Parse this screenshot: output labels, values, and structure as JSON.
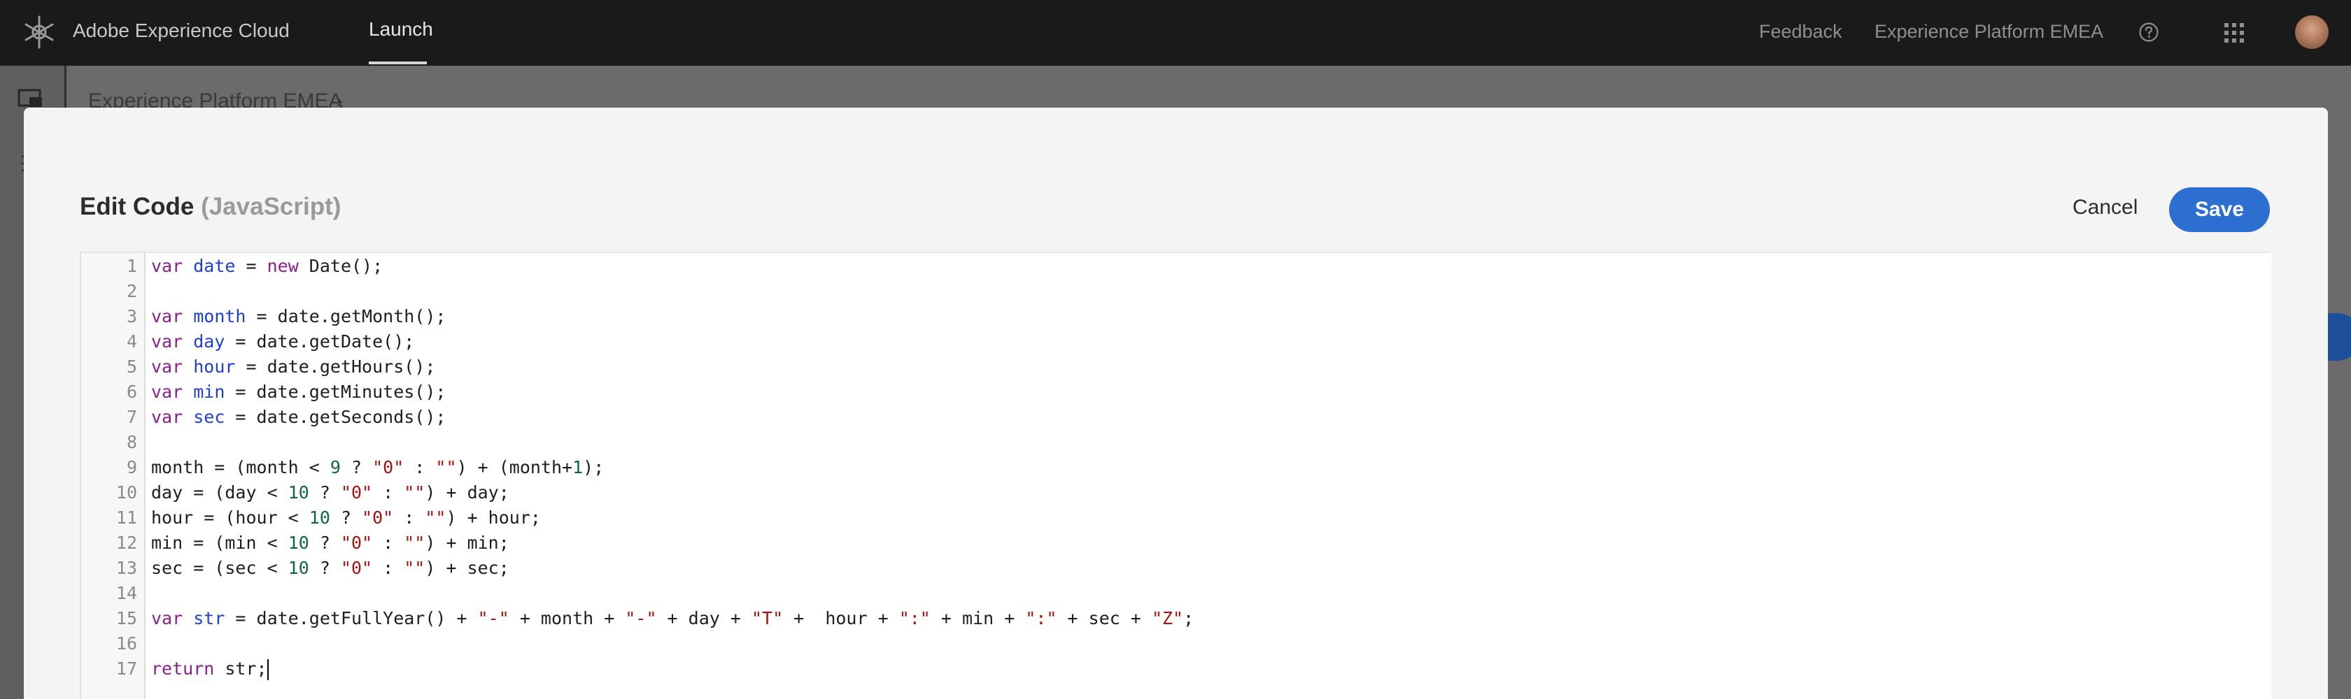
{
  "header": {
    "app_title": "Adobe Experience Cloud",
    "nav_launch": "Launch",
    "feedback": "Feedback",
    "org": "Experience Platform EMEA",
    "help_icon": "help-circle-icon",
    "apps_icon": "app-grid-icon"
  },
  "background": {
    "breadcrumb": "Experience Platform EMEA",
    "chevron": "›"
  },
  "modal": {
    "title": "Edit Code",
    "language": "(JavaScript)",
    "cancel": "Cancel",
    "save": "Save"
  },
  "editor": {
    "line_numbers": [
      "1",
      "2",
      "3",
      "4",
      "5",
      "6",
      "7",
      "8",
      "9",
      "10",
      "11",
      "12",
      "13",
      "14",
      "15",
      "16",
      "17"
    ],
    "lines": [
      [
        {
          "t": "var",
          "c": "kw"
        },
        {
          "t": " "
        },
        {
          "t": "date",
          "c": "def"
        },
        {
          "t": " = "
        },
        {
          "t": "new",
          "c": "kw"
        },
        {
          "t": " Date();"
        }
      ],
      [],
      [
        {
          "t": "var",
          "c": "kw"
        },
        {
          "t": " "
        },
        {
          "t": "month",
          "c": "def"
        },
        {
          "t": " = date.getMonth();"
        }
      ],
      [
        {
          "t": "var",
          "c": "kw"
        },
        {
          "t": " "
        },
        {
          "t": "day",
          "c": "def"
        },
        {
          "t": " = date.getDate();"
        }
      ],
      [
        {
          "t": "var",
          "c": "kw"
        },
        {
          "t": " "
        },
        {
          "t": "hour",
          "c": "def"
        },
        {
          "t": " = date.getHours();"
        }
      ],
      [
        {
          "t": "var",
          "c": "kw"
        },
        {
          "t": " "
        },
        {
          "t": "min",
          "c": "def"
        },
        {
          "t": " = date.getMinutes();"
        }
      ],
      [
        {
          "t": "var",
          "c": "kw"
        },
        {
          "t": " "
        },
        {
          "t": "sec",
          "c": "def"
        },
        {
          "t": " = date.getSeconds();"
        }
      ],
      [],
      [
        {
          "t": "month = (month < "
        },
        {
          "t": "9",
          "c": "num"
        },
        {
          "t": " ? "
        },
        {
          "t": "\"0\"",
          "c": "str"
        },
        {
          "t": " : "
        },
        {
          "t": "\"\"",
          "c": "str"
        },
        {
          "t": ") + (month+"
        },
        {
          "t": "1",
          "c": "num"
        },
        {
          "t": ");"
        }
      ],
      [
        {
          "t": "day = (day < "
        },
        {
          "t": "10",
          "c": "num"
        },
        {
          "t": " ? "
        },
        {
          "t": "\"0\"",
          "c": "str"
        },
        {
          "t": " : "
        },
        {
          "t": "\"\"",
          "c": "str"
        },
        {
          "t": ") + day;"
        }
      ],
      [
        {
          "t": "hour = (hour < "
        },
        {
          "t": "10",
          "c": "num"
        },
        {
          "t": " ? "
        },
        {
          "t": "\"0\"",
          "c": "str"
        },
        {
          "t": " : "
        },
        {
          "t": "\"\"",
          "c": "str"
        },
        {
          "t": ") + hour;"
        }
      ],
      [
        {
          "t": "min = (min < "
        },
        {
          "t": "10",
          "c": "num"
        },
        {
          "t": " ? "
        },
        {
          "t": "\"0\"",
          "c": "str"
        },
        {
          "t": " : "
        },
        {
          "t": "\"\"",
          "c": "str"
        },
        {
          "t": ") + min;"
        }
      ],
      [
        {
          "t": "sec = (sec < "
        },
        {
          "t": "10",
          "c": "num"
        },
        {
          "t": " ? "
        },
        {
          "t": "\"0\"",
          "c": "str"
        },
        {
          "t": " : "
        },
        {
          "t": "\"\"",
          "c": "str"
        },
        {
          "t": ") + sec;"
        }
      ],
      [],
      [
        {
          "t": "var",
          "c": "kw"
        },
        {
          "t": " "
        },
        {
          "t": "str",
          "c": "def"
        },
        {
          "t": " = date.getFullYear() + "
        },
        {
          "t": "\"-\"",
          "c": "str"
        },
        {
          "t": " + month + "
        },
        {
          "t": "\"-\"",
          "c": "str"
        },
        {
          "t": " + day + "
        },
        {
          "t": "\"T\"",
          "c": "str"
        },
        {
          "t": " +  hour + "
        },
        {
          "t": "\":\"",
          "c": "str"
        },
        {
          "t": " + min + "
        },
        {
          "t": "\":\"",
          "c": "str"
        },
        {
          "t": " + sec + "
        },
        {
          "t": "\"Z\"",
          "c": "str"
        },
        {
          "t": ";"
        }
      ],
      [],
      [
        {
          "t": "return",
          "c": "kw"
        },
        {
          "t": " str;"
        }
      ]
    ],
    "cursor_line": 17
  },
  "colors": {
    "topbar": "#1a1a1a",
    "accent": "#2d6fd0",
    "keyword": "#8b1f8b",
    "definition": "#1f3fd0",
    "number": "#116644",
    "string": "#aa1111"
  }
}
